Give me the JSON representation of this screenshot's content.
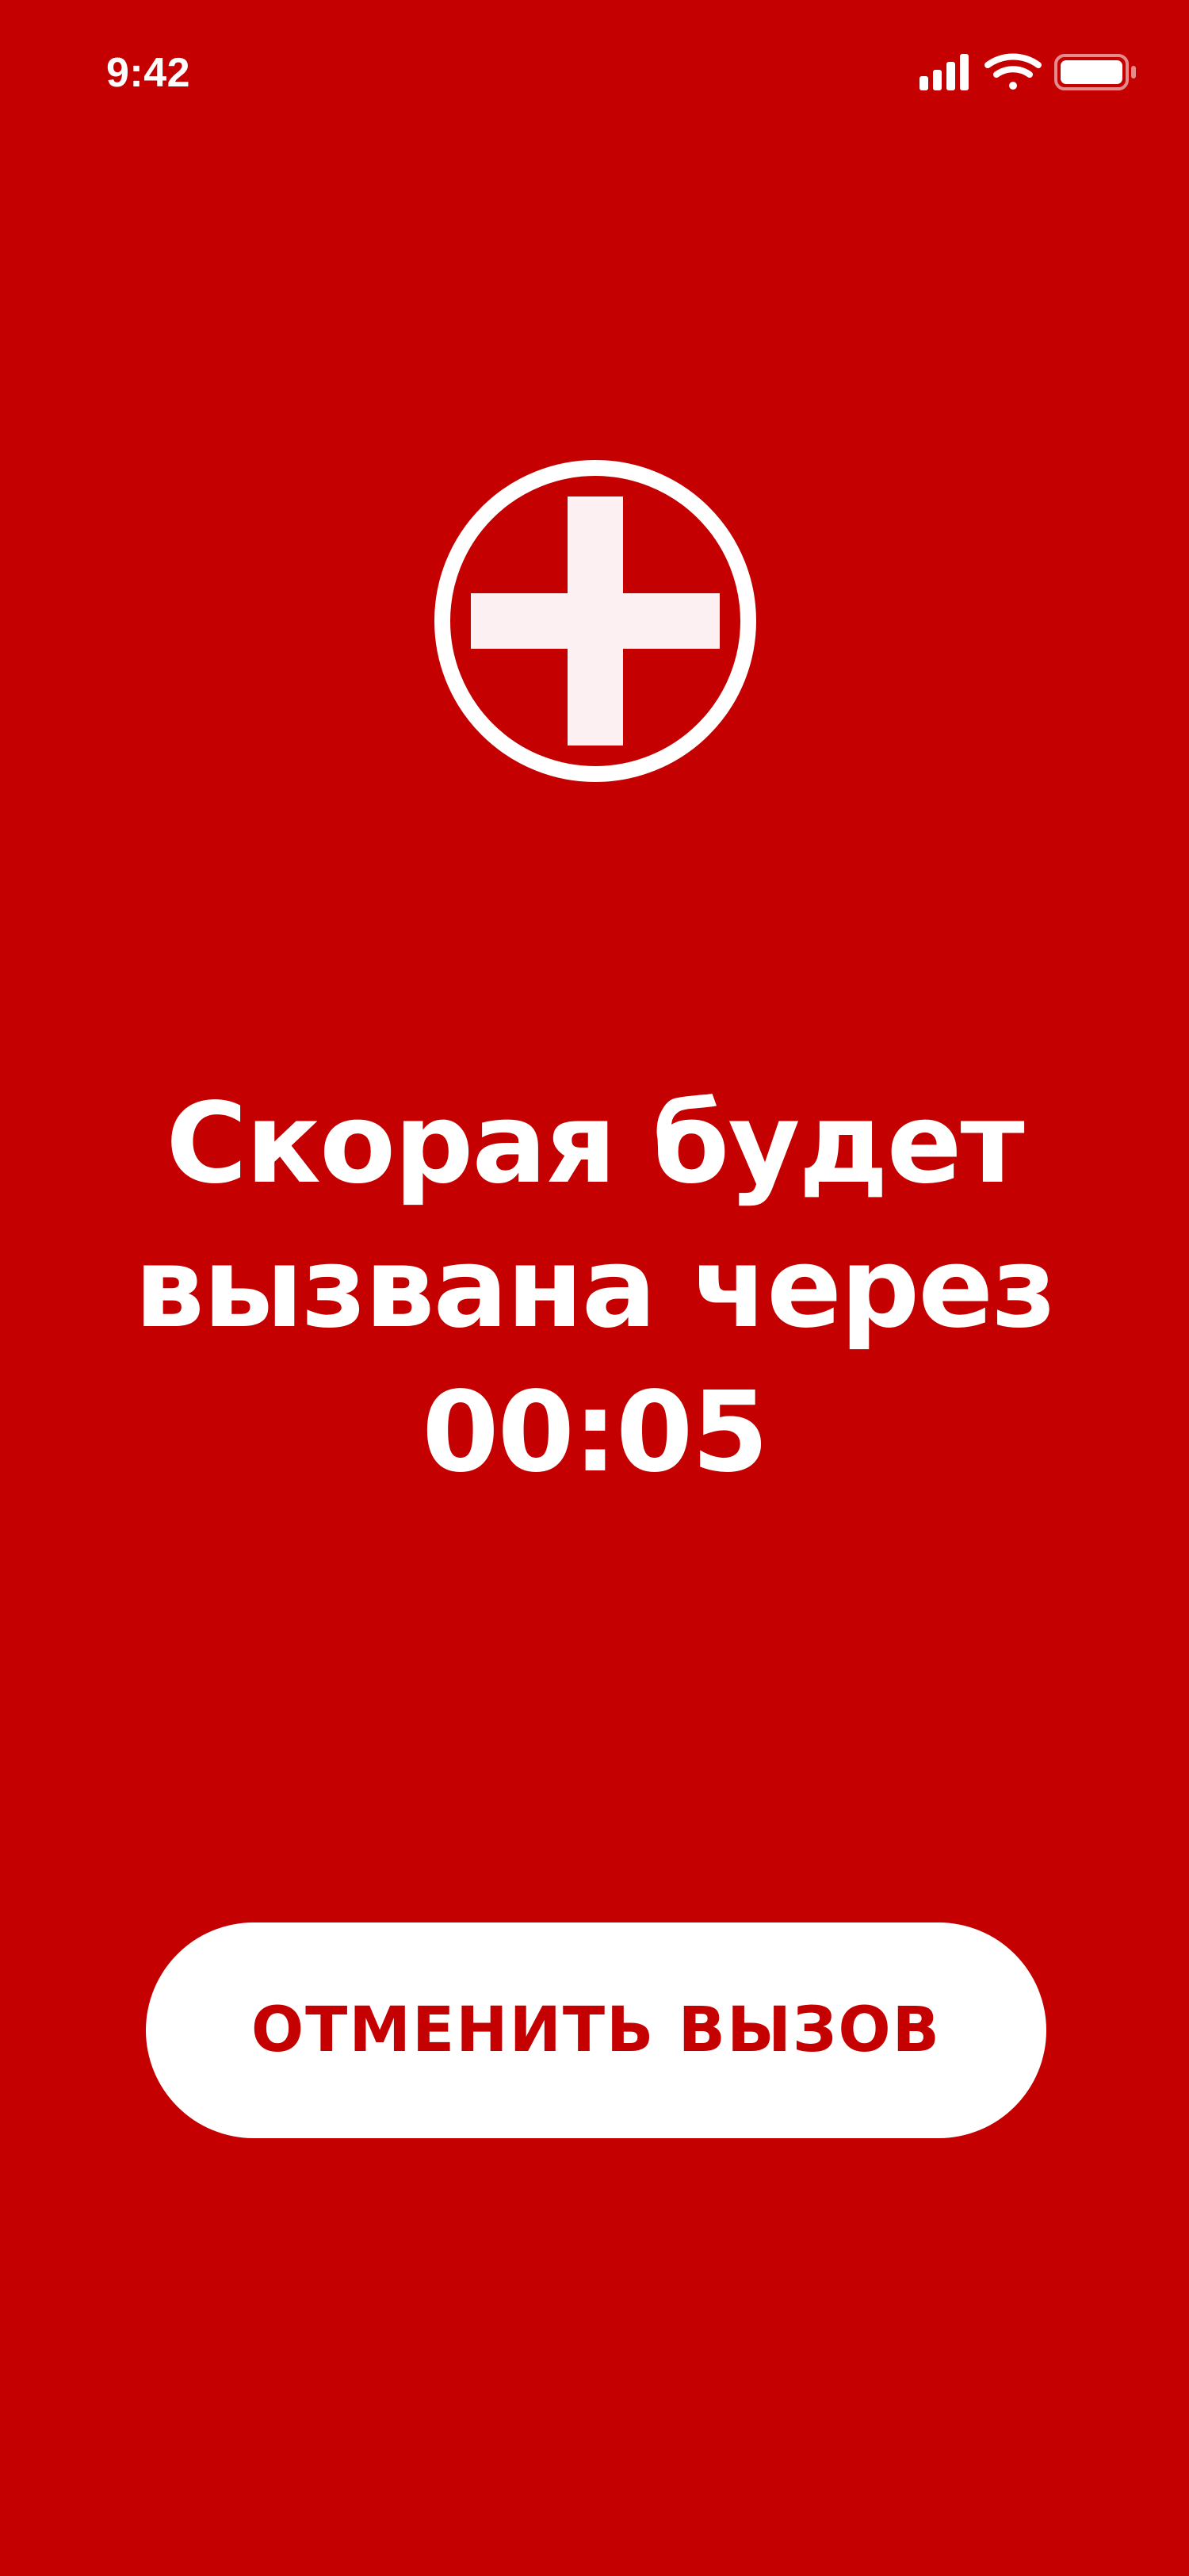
{
  "status_bar": {
    "time": "9:42",
    "icons": [
      "signal-icon",
      "wifi-icon",
      "battery-icon"
    ]
  },
  "emblem": {
    "icon": "medical-cross-icon"
  },
  "message": {
    "line1": "Скорая будет",
    "line2": "вызвана через",
    "countdown": "00:05"
  },
  "actions": {
    "cancel_label": "ОТМЕНИТЬ ВЫЗОВ"
  },
  "colors": {
    "background": "#c40000",
    "foreground": "#ffffff",
    "button_background": "#ffffff",
    "button_text": "#c40000"
  }
}
